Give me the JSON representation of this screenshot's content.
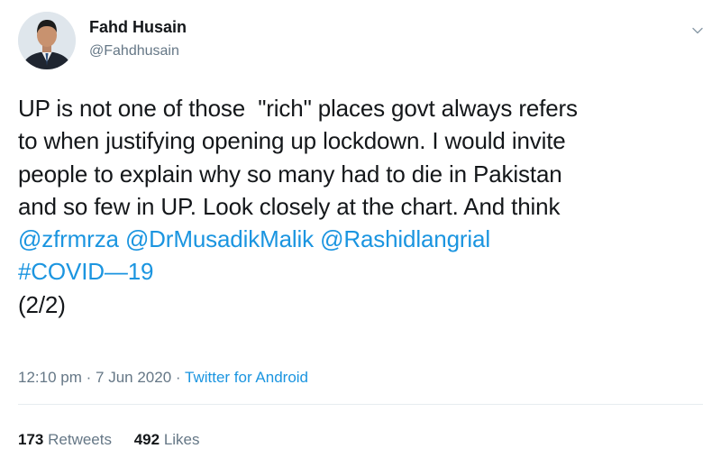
{
  "author": {
    "name": "Fahd Husain",
    "handle": "@Fahdhusain"
  },
  "tweet": {
    "lines": [
      "UP is not one of those  \"rich\" places govt always refers",
      "to when justifying opening up lockdown. I would invite",
      "people to explain why so many had to die in Pakistan",
      "and so few in UP. Look closely at the chart. And think"
    ],
    "mentions": [
      "@zfrmrza",
      "@DrMusadikMalik",
      "@Rashidlangrial"
    ],
    "hashtag": "#COVID—19",
    "suffix": "(2/2)"
  },
  "meta": {
    "time": "12:10 pm",
    "separator": "·",
    "date": "7 Jun 2020",
    "source": "Twitter for Android"
  },
  "stats": {
    "retweets_count": "173",
    "retweets_label": "Retweets",
    "likes_count": "492",
    "likes_label": "Likes"
  },
  "colors": {
    "link": "#1b95e0",
    "secondary_text": "#657786",
    "primary_text": "#14171a"
  },
  "icons": {
    "menu": "chevron-down-icon"
  }
}
